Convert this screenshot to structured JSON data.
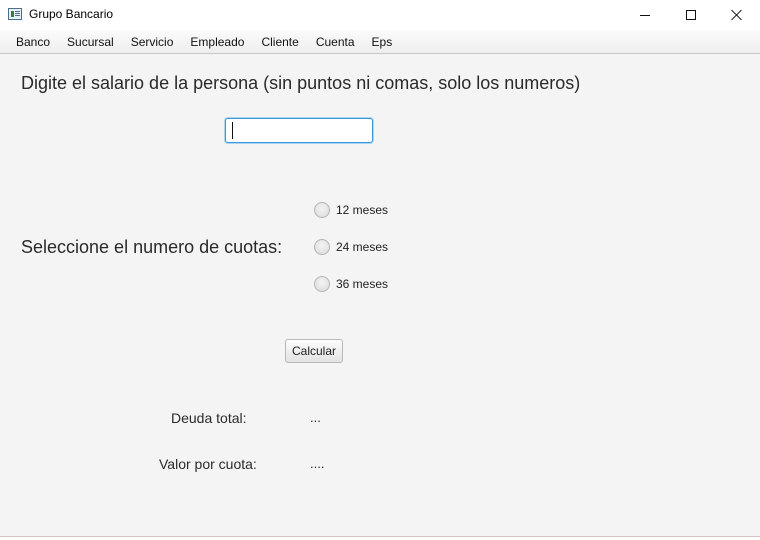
{
  "window": {
    "title": "Grupo Bancario",
    "icon": "app-window-icon"
  },
  "menu": {
    "items": [
      "Banco",
      "Sucursal",
      "Servicio",
      "Empleado",
      "Cliente",
      "Cuenta",
      "Eps"
    ]
  },
  "form": {
    "salary_prompt": "Digite el salario de la persona (sin puntos ni comas, solo los numeros)",
    "salary_value": "",
    "installments_prompt": "Seleccione el numero de cuotas:",
    "options": [
      "12 meses",
      "24 meses",
      "36 meses"
    ],
    "selected_option": null,
    "calculate_label": "Calcular"
  },
  "results": {
    "total_debt_label": "Deuda total:",
    "total_debt_value": "...",
    "installment_label": "Valor por cuota:",
    "installment_value": "...."
  },
  "colors": {
    "focus_border": "#3b99d9",
    "content_background": "#f4f4f4"
  }
}
